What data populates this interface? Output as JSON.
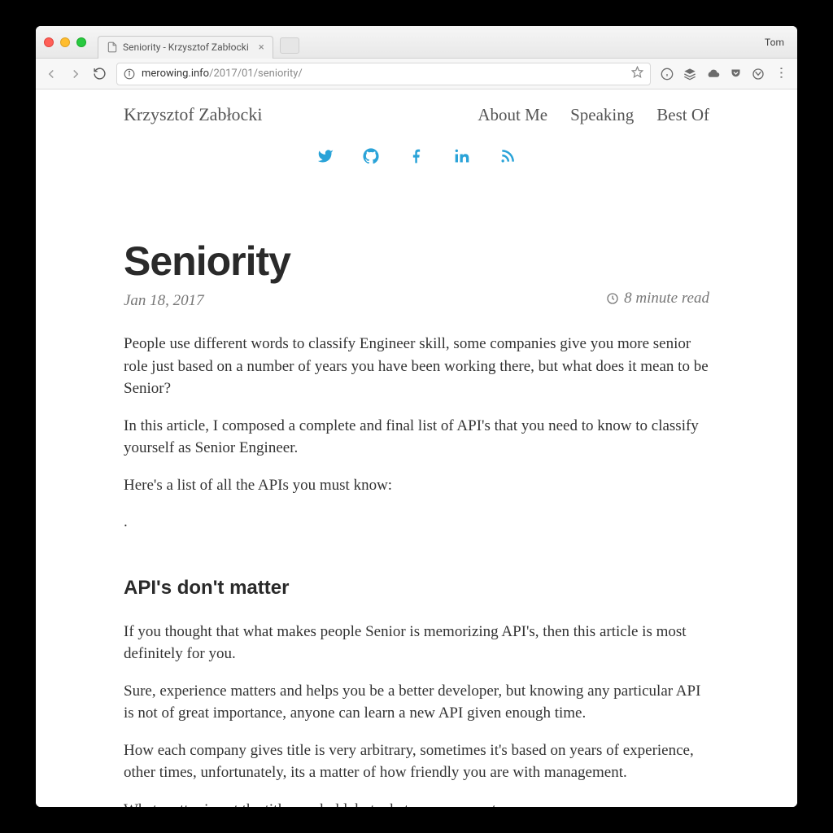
{
  "chrome": {
    "profile_name": "Tom",
    "tab_title": "Seniority - Krzysztof Zabłocki",
    "url_host": "merowing.info",
    "url_path": "/2017/01/seniority/"
  },
  "header": {
    "site_title": "Krzysztof Zabłocki",
    "nav": [
      "About Me",
      "Speaking",
      "Best Of"
    ]
  },
  "article": {
    "title": "Seniority",
    "date": "Jan 18, 2017",
    "read_time": "8 minute read",
    "paragraphs_intro": [
      "People use different words to classify Engineer skill, some companies give you more senior role just based on a number of years you have been working there, but what does it mean to be Senior?",
      "In this article, I composed a complete and final list of API's that you need to know to classify yourself as Senior Engineer.",
      "Here's a list of all the APIs you must know:",
      "."
    ],
    "section_heading": "API's don't matter",
    "paragraphs_section": [
      "If you thought that what makes people Senior is memorizing API's, then this article is most definitely for you.",
      "Sure, experience matters and helps you be a better developer, but knowing any particular API is not of great importance, anyone can learn a new API given enough time.",
      "How each company gives title is very arbitrary, sometimes it's based on years of experience, other times, unfortunately, its a matter of how friendly you are with management.",
      "What matter is not the title you hold, but what you represent."
    ]
  }
}
